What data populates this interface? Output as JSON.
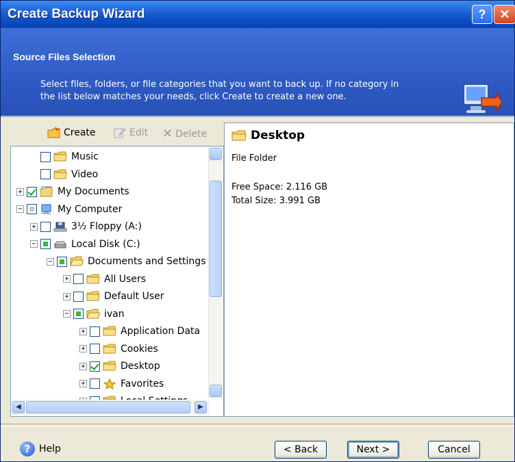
{
  "window": {
    "title": "Create Backup Wizard",
    "help_glyph": "?",
    "close_glyph": "✕"
  },
  "header": {
    "title": "Source Files Selection",
    "description_line1": "Select files, folders, or file categories that you want to back up. If no category in",
    "description_line2": "the list below matches your needs, click Create to create a new one.",
    "icon": "computer-backup-icon"
  },
  "toolbar": {
    "create": "Create",
    "edit": "Edit",
    "delete": "Delete"
  },
  "tree": {
    "items": [
      {
        "label": "Music",
        "state": "unchecked",
        "expander": "",
        "icon": "folder-icon"
      },
      {
        "label": "Video",
        "state": "unchecked",
        "expander": "",
        "icon": "folder-icon"
      },
      {
        "label": "My Documents",
        "state": "checked",
        "expander": "+",
        "icon": "documents-icon"
      },
      {
        "label": "My Computer",
        "state": "partial-gray",
        "expander": "−",
        "icon": "computer-icon"
      },
      {
        "label": "3½ Floppy (A:)",
        "state": "unchecked",
        "expander": "+",
        "icon": "floppy-icon"
      },
      {
        "label": "Local Disk (C:)",
        "state": "partial",
        "expander": "−",
        "icon": "disk-icon"
      },
      {
        "label": "Documents and Settings",
        "state": "partial",
        "expander": "−",
        "icon": "folder-open-icon"
      },
      {
        "label": "All Users",
        "state": "unchecked",
        "expander": "+",
        "icon": "folder-icon"
      },
      {
        "label": "Default User",
        "state": "unchecked",
        "expander": "+",
        "icon": "folder-icon"
      },
      {
        "label": "ivan",
        "state": "partial",
        "expander": "−",
        "icon": "folder-open-icon"
      },
      {
        "label": "Application Data",
        "state": "unchecked",
        "expander": "+",
        "icon": "folder-icon"
      },
      {
        "label": "Cookies",
        "state": "unchecked",
        "expander": "+",
        "icon": "folder-icon"
      },
      {
        "label": "Desktop",
        "state": "checked",
        "expander": "+",
        "icon": "folder-icon"
      },
      {
        "label": "Favorites",
        "state": "unchecked",
        "expander": "+",
        "icon": "star-icon"
      },
      {
        "label": "Local Settings",
        "state": "unchecked",
        "expander": "+",
        "icon": "folder-icon"
      }
    ]
  },
  "details": {
    "title": "Desktop",
    "type": "File Folder",
    "free_space": "Free Space: 2.116 GB",
    "total_size": "Total Size: 3.991 GB"
  },
  "footer": {
    "help": "Help",
    "back": "< Back",
    "next": "Next >",
    "cancel": "Cancel"
  },
  "colors": {
    "titlebar": "#0b4fc4",
    "header": "#2e5ac4",
    "check_green": "#21a121",
    "face": "#ece9d8"
  }
}
